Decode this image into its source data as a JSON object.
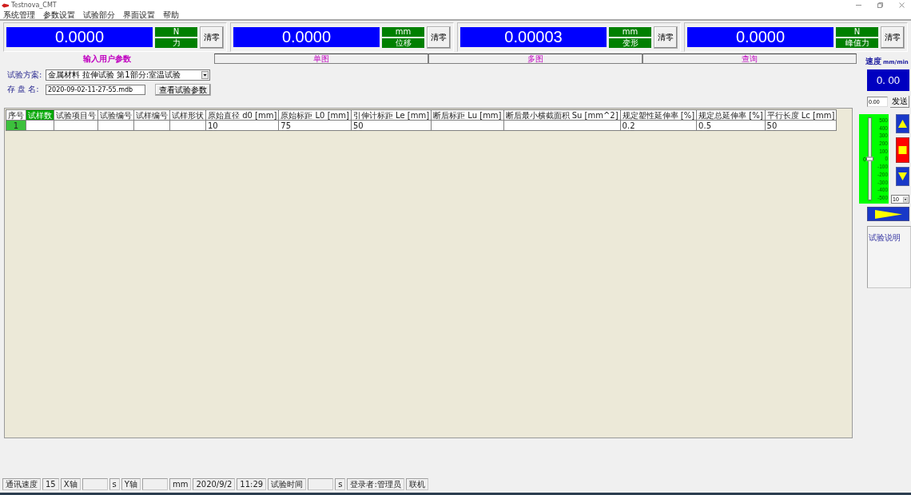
{
  "window": {
    "title": "Testnova_CMT"
  },
  "menu": [
    "系统管理",
    "参数设置",
    "试验部分",
    "界面设置",
    "帮助"
  ],
  "readouts": [
    {
      "value": "0.0000",
      "unit": "N",
      "name": "力",
      "button": "清零"
    },
    {
      "value": "0.0000",
      "unit": "mm",
      "name": "位移",
      "button": "清零"
    },
    {
      "value": "0.00003",
      "unit": "mm",
      "name": "变形",
      "button": "清零"
    },
    {
      "value": "0.0000",
      "unit": "N",
      "name": "峰值力",
      "button": "清零"
    }
  ],
  "tabs": [
    {
      "label": "输入用户参数",
      "selected": true
    },
    {
      "label": "单图",
      "selected": false
    },
    {
      "label": "多图",
      "selected": false
    },
    {
      "label": "查询",
      "selected": false
    }
  ],
  "form": {
    "scheme_label": "试验方案:",
    "scheme_value": "金属材料 拉伸试验 第1部分:室温试验",
    "file_label": "存 盘 名:",
    "file_value": "2020-09-02-11-27-55.mdb",
    "view_button": "查看试验参数"
  },
  "table": {
    "columns": [
      {
        "label": "序号",
        "selected": false
      },
      {
        "label": "试样数",
        "selected": true
      },
      {
        "label": "试验项目号",
        "selected": false
      },
      {
        "label": "试验编号",
        "selected": false
      },
      {
        "label": "试样编号",
        "selected": false
      },
      {
        "label": "试样形状",
        "selected": false
      },
      {
        "label": "原始直径 d0 [mm]",
        "selected": false
      },
      {
        "label": "原始标距 L0 [mm]",
        "selected": false
      },
      {
        "label": "引伸计标距 Le [mm]",
        "selected": false
      },
      {
        "label": "断后标距 Lu [mm]",
        "selected": false
      },
      {
        "label": "断后最小横截面积 Su [mm^2]",
        "selected": false
      },
      {
        "label": "规定塑性延伸率 [%]",
        "selected": false
      },
      {
        "label": "规定总延伸率 [%]",
        "selected": false
      },
      {
        "label": "平行长度 Lc [mm]",
        "selected": false
      }
    ],
    "rows": [
      {
        "selected": true,
        "cells": [
          "1",
          null,
          null,
          null,
          null,
          null,
          "10",
          "75",
          "50",
          null,
          null,
          "0.2",
          "0.5",
          "50"
        ]
      }
    ]
  },
  "speed_panel": {
    "label": "速度",
    "unit": "mm/min",
    "value": "0. 00",
    "input_value": "0.00",
    "send_button": "发送"
  },
  "jog": {
    "reading": "0",
    "level": 0.5,
    "scale": [
      "500",
      "400",
      "300",
      "200",
      "100",
      "0",
      "-100",
      "-200",
      "-300",
      "-400",
      "-500"
    ],
    "step": "10"
  },
  "notes": {
    "label": "试验说明"
  },
  "status_bar": [
    {
      "kind": "text",
      "text": "通讯速度"
    },
    {
      "kind": "text",
      "text": "15"
    },
    {
      "kind": "text",
      "text": "X轴"
    },
    {
      "kind": "blank"
    },
    {
      "kind": "text",
      "text": "s"
    },
    {
      "kind": "text",
      "text": "Y轴"
    },
    {
      "kind": "blank"
    },
    {
      "kind": "text",
      "text": "mm"
    },
    {
      "kind": "text",
      "text": "2020/9/2"
    },
    {
      "kind": "text",
      "text": "11:29"
    },
    {
      "kind": "text",
      "text": "试验时间"
    },
    {
      "kind": "blank"
    },
    {
      "kind": "text",
      "text": "s"
    },
    {
      "kind": "text",
      "text": "登录者:管理员"
    },
    {
      "kind": "text",
      "text": "联机"
    }
  ]
}
